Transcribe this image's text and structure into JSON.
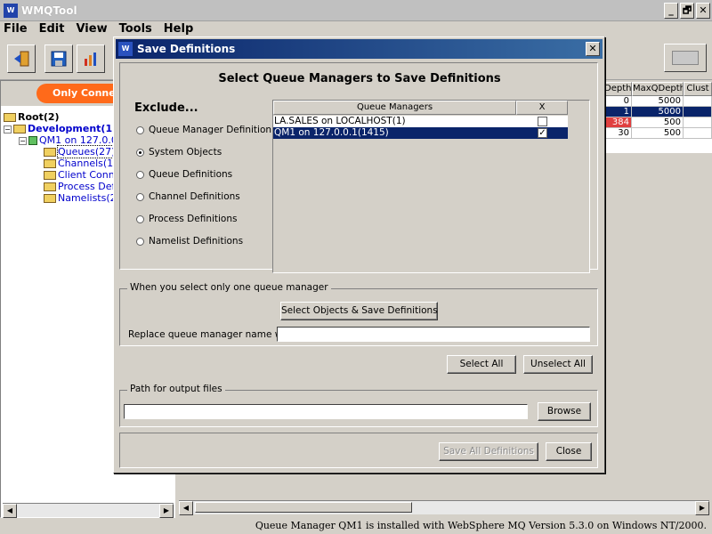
{
  "app": {
    "title": "WMQTool",
    "icon": "wmq-logo-icon",
    "window_controls": [
      "_",
      "🗗",
      "✕"
    ]
  },
  "menu": [
    "File",
    "Edit",
    "View",
    "Tools",
    "Help"
  ],
  "toolbar": {
    "buttons": [
      "exit-icon",
      "save-icon",
      "chart-icon"
    ]
  },
  "left_panel": {
    "filter_label": "Only Connected",
    "tree": [
      {
        "label": "Root(2)",
        "level": 0
      },
      {
        "label": "Development(1)",
        "level": 1
      },
      {
        "label": "QM1  on 127.0.0.1(1415)",
        "level": 2
      },
      {
        "label": "Queues(27)",
        "level": 3
      },
      {
        "label": "Channels(12)",
        "level": 3
      },
      {
        "label": "Client Connections",
        "level": 3
      },
      {
        "label": "Process Definitions",
        "level": 3
      },
      {
        "label": "Namelists(2)",
        "level": 3
      }
    ]
  },
  "right_table": {
    "columns": [
      "Depth",
      "MaxQDepth",
      "Clust"
    ],
    "rows": [
      {
        "depth": "0",
        "max": "5000",
        "highlight": "none"
      },
      {
        "depth": "1",
        "max": "5000",
        "highlight": "selected"
      },
      {
        "depth": "384",
        "max": "500",
        "highlight": "red"
      },
      {
        "depth": "30",
        "max": "500",
        "highlight": "none"
      }
    ]
  },
  "status_text": "Queue Manager QM1  is installed with WebSphere MQ Version 5.3.0 on Windows NT/2000.",
  "dialog": {
    "title": "Save Definitions",
    "heading": "Select Queue Managers to Save Definitions",
    "exclude_label": "Exclude...",
    "exclude_options": [
      {
        "label": "Queue Manager Definition",
        "checked": false
      },
      {
        "label": "System Objects",
        "checked": true
      },
      {
        "label": "Queue Definitions",
        "checked": false
      },
      {
        "label": "Channel Definitions",
        "checked": false
      },
      {
        "label": "Process Definitions",
        "checked": false
      },
      {
        "label": "Namelist Definitions",
        "checked": false
      }
    ],
    "table": {
      "col_name": "Queue Managers",
      "col_check": "X",
      "rows": [
        {
          "name": "LA.SALES  on LOCALHOST(1)",
          "checked": false,
          "selected": false
        },
        {
          "name": "QM1  on 127.0.0.1(1415)",
          "checked": true,
          "selected": true
        }
      ]
    },
    "single_group_title": "When you select only one queue manager",
    "select_objects_button": "Select Objects & Save Definitions",
    "replace_label": "Replace queue manager name with",
    "replace_value": "",
    "select_all_button": "Select All",
    "unselect_all_button": "Unselect All",
    "path_group_title": "Path for output files",
    "path_value": "",
    "browse_button": "Browse",
    "save_all_button": "Save All Definitions",
    "close_button": "Close"
  }
}
